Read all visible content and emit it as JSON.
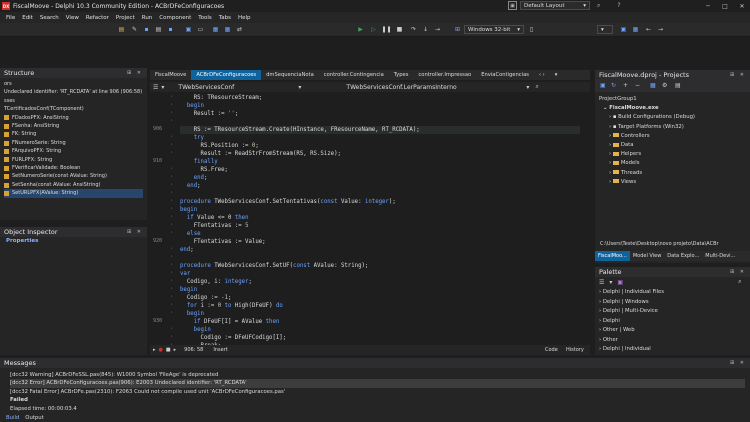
{
  "window": {
    "title": "FiscalMoove - Delphi 10.3 Community Edition - ACBrDFeConfiguracoes",
    "logo_text": "DX",
    "layout_label": "Default Layout",
    "controls": [
      "─",
      "□",
      "✕"
    ]
  },
  "menu": [
    "File",
    "Edit",
    "Search",
    "View",
    "Refactor",
    "Project",
    "Run",
    "Component",
    "Tools",
    "Tabs",
    "Help"
  ],
  "toolbar": {
    "platform": "Windows 32-bit",
    "accent": "#3fa45a"
  },
  "structure": {
    "title": "Structure",
    "pins": "⊞ ✕",
    "items": [
      {
        "text": "ors",
        "icon": false
      },
      {
        "text": "Undeclared identifier: 'RT_RCDATA' at line 906 (906:58)",
        "icon": false
      },
      {
        "text": "sses",
        "icon": false
      },
      {
        "text": "TCertificadosConf(TComponent)",
        "icon": false
      },
      {
        "text": "FDadosPFX: AnsiString",
        "icon": true
      },
      {
        "text": "FSenha: AnsiString",
        "icon": true
      },
      {
        "text": "FK: String",
        "icon": true
      },
      {
        "text": "FNumeroSerie: String",
        "icon": true
      },
      {
        "text": "FArquivoPFX: String",
        "icon": true
      },
      {
        "text": "FURLPFX: String",
        "icon": true
      },
      {
        "text": "FVerificarValidade: Boolean",
        "icon": true
      },
      {
        "text": "SetNumeroSerie(const AValue: String)",
        "icon": true
      },
      {
        "text": "SetSenha(const AValue: AnsiString)",
        "icon": true
      },
      {
        "text": "SetURLPFX(AValue: String)",
        "icon": true
      }
    ]
  },
  "object_inspector": {
    "title": "Object Inspector",
    "tab": "Properties"
  },
  "editor": {
    "tabs": [
      "FiscalMoove",
      "ACBrDFeConfiguracoes",
      "dmSequenciaNota",
      "controller.Contingencia",
      "Types",
      "controller.Impressao",
      "EnviaContigencias"
    ],
    "active_tab": 1,
    "nav_class": "TWebServicesConf",
    "nav_method": "TWebServicesConf.LerParamsInterno",
    "lines": [
      {
        "ln": "",
        "text": "    RS: TResourceStream;"
      },
      {
        "ln": "",
        "text": "  begin"
      },
      {
        "ln": "",
        "text": "    Result := '';"
      },
      {
        "ln": "",
        "text": ""
      },
      {
        "ln": "906",
        "text": "    RS := TResourceStream.Create(HInstance, FResourceName, RT_RCDATA);"
      },
      {
        "ln": "",
        "text": "    try"
      },
      {
        "ln": "",
        "text": "      RS.Position := 0;"
      },
      {
        "ln": "",
        "text": "      Result := ReadStrFromStream(RS, RS.Size);"
      },
      {
        "ln": "910",
        "text": "    finally"
      },
      {
        "ln": "",
        "text": "      RS.Free;"
      },
      {
        "ln": "",
        "text": "    end;"
      },
      {
        "ln": "",
        "text": "  end;"
      },
      {
        "ln": "",
        "text": ""
      },
      {
        "ln": "",
        "text": "procedure TWebServicesConf.SetTentativas(const Value: integer);"
      },
      {
        "ln": "",
        "text": "begin"
      },
      {
        "ln": "",
        "text": "  if Value <= 0 then"
      },
      {
        "ln": "",
        "text": "    FTentativas := 5"
      },
      {
        "ln": "",
        "text": "  else"
      },
      {
        "ln": "920",
        "text": "    FTentativas := Value;"
      },
      {
        "ln": "",
        "text": "end;"
      },
      {
        "ln": "",
        "text": ""
      },
      {
        "ln": "",
        "text": "procedure TWebServicesConf.SetUF(const AValue: String);"
      },
      {
        "ln": "",
        "text": "var"
      },
      {
        "ln": "",
        "text": "  Codigo, i: integer;"
      },
      {
        "ln": "",
        "text": "begin"
      },
      {
        "ln": "",
        "text": "  Codigo := -1;"
      },
      {
        "ln": "",
        "text": "  for i := 0 to High(DFeUF) do"
      },
      {
        "ln": "",
        "text": "  begin"
      },
      {
        "ln": "930",
        "text": "    if DFeUF[I] = AValue then"
      },
      {
        "ln": "",
        "text": "    begin"
      },
      {
        "ln": "",
        "text": "      Codigo := DFeUFCodigo[I];"
      },
      {
        "ln": "",
        "text": "      Break;"
      }
    ],
    "status_pos": "906: 58",
    "status_mode": "Insert",
    "code_tab": "Code",
    "history_tab": "History"
  },
  "project": {
    "title": "FiscalMoove.dproj - Projects",
    "group": "ProjectGroup1",
    "exe": "FiscalMoove.exe",
    "nodes": [
      "Build Configurations (Debug)",
      "Target Platforms (Win32)",
      "Controllers",
      "Data",
      "Helpers",
      "Models",
      "Threads",
      "Views"
    ],
    "path": "C:\\Users\\Teste\\Desktop\\novo projeto\\Data\\ACBr",
    "tabs": [
      "FiscalMoo...",
      "Model View",
      "Data Explo...",
      "Multi-Devi..."
    ]
  },
  "palette": {
    "title": "Palette",
    "items": [
      "Delphi | Individual Files",
      "Delphi | Windows",
      "Delphi | Multi-Device",
      "Delphi",
      "Other | Web",
      "Other",
      "Delphi | Individual"
    ]
  },
  "messages": {
    "title": "Messages",
    "lines": [
      "[dcc32 Warning] ACBrDFeSSL.pas(845): W1000 Symbol 'FileAge' is deprecated",
      "[dcc32 Error] ACBrDFeConfiguracoes.pas(906): E2003 Undeclared identifier: 'RT_RCDATA'",
      "[dcc32 Fatal Error] ACBrDFe.pas(2310): F2063 Could not compile used unit 'ACBrDFeConfiguracoes.pas'",
      "Failed",
      "Elapsed time: 00:00:03.4"
    ],
    "tabs": [
      "Build",
      "Output"
    ]
  }
}
